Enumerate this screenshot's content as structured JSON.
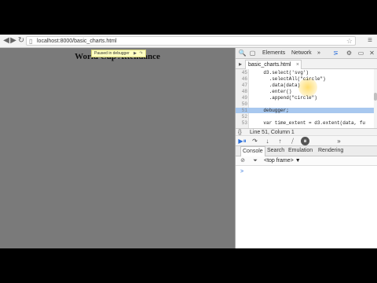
{
  "browser": {
    "url": "localhost:8000/basic_charts.html",
    "nav": {
      "back_icon": "◀",
      "forward_icon": "▶",
      "reload_icon": "↻",
      "page_icon": "▯",
      "star_icon": "☆",
      "menu_icon": "≡"
    }
  },
  "page": {
    "title": "World Cup Attendance",
    "paused_text": "Paused in debugger",
    "paused_icons": [
      "▶",
      "↷"
    ],
    "background": "#7a7a7a"
  },
  "devtools": {
    "tabs": [
      "Elements",
      "Network"
    ],
    "more_tabs_icon": "»",
    "icons": {
      "search": "🔍",
      "console_drawer": "⋝",
      "settings": "⚙",
      "dock": "▭",
      "close": "✕"
    },
    "file_tab": "basic_charts.html",
    "file_close_icon": "×",
    "editor": {
      "lines": [
        {
          "n": "45",
          "text": "    d3.select('svg')"
        },
        {
          "n": "46",
          "text": "      .selectAll(\"circle\")"
        },
        {
          "n": "47",
          "text": "      .data(data)"
        },
        {
          "n": "48",
          "text": "      .enter()"
        },
        {
          "n": "49",
          "text": "      .append(\"circle\")"
        },
        {
          "n": "50",
          "text": ""
        },
        {
          "n": "51",
          "text": "    debugger;"
        },
        {
          "n": "52",
          "text": ""
        },
        {
          "n": "53",
          "text": "    var time_extent = d3.extent(data, fu"
        }
      ],
      "highlighted_line": "51"
    },
    "status": {
      "braces": "{}",
      "text": "Line 51, Column 1"
    },
    "debugger_icons": [
      "▶⏸",
      "↷",
      "↓",
      "↑",
      "⧸",
      "⏸"
    ],
    "debugger_more_icon": "»",
    "drawer_tabs": [
      "Console",
      "Search",
      "Emulation",
      "Rendering"
    ],
    "console": {
      "clear_icon": "⊘",
      "filter_icon": "⏷",
      "frame": "<top frame>",
      "frame_arrow": "▼",
      "prompt": ">"
    }
  },
  "colors": {
    "highlight": "#a8c8ef",
    "accent": "#2a6fdb",
    "letterbox": "#000000"
  }
}
